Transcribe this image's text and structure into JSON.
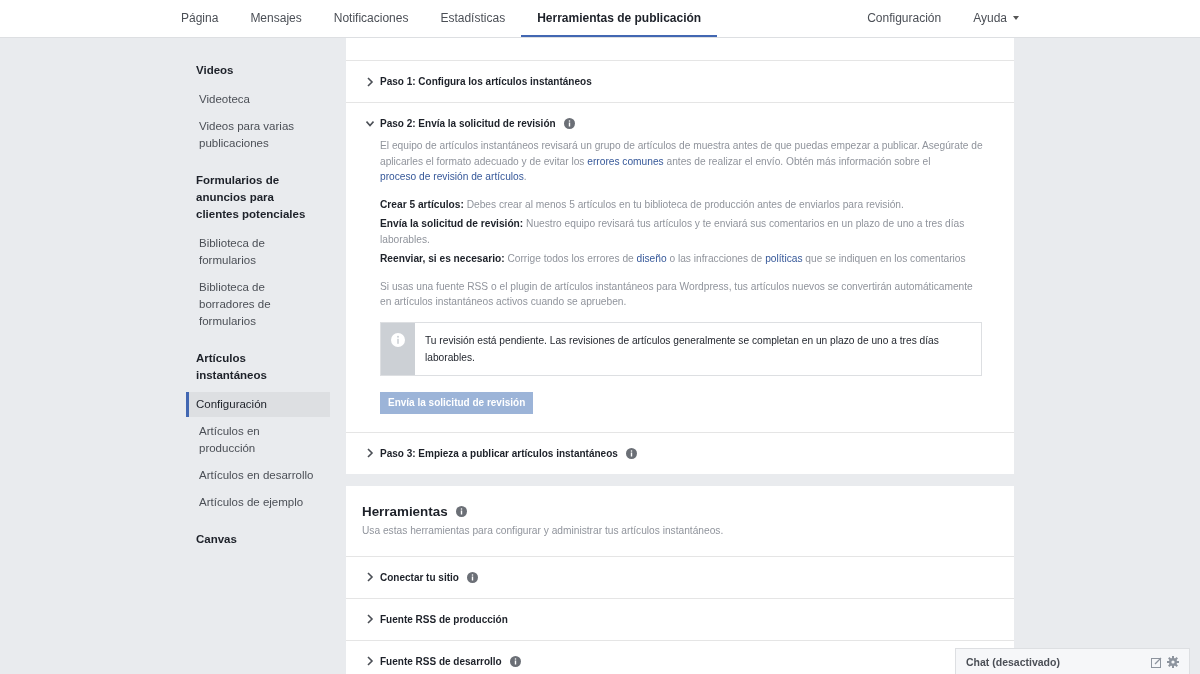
{
  "nav": {
    "tabs": [
      {
        "label": "Página",
        "selected": false
      },
      {
        "label": "Mensajes",
        "selected": false
      },
      {
        "label": "Notificaciones",
        "selected": false
      },
      {
        "label": "Estadísticas",
        "selected": false
      },
      {
        "label": "Herramientas de publicación",
        "selected": true
      }
    ],
    "right": [
      {
        "label": "Configuración",
        "kind": "link"
      },
      {
        "label": "Ayuda",
        "kind": "dropdown"
      }
    ]
  },
  "sidebar": {
    "sections": [
      {
        "title": "Videos",
        "items": [
          {
            "label": "Videoteca",
            "selected": false
          },
          {
            "label": "Videos para varias publicaciones",
            "selected": false
          }
        ]
      },
      {
        "title": "Formularios de anuncios para clientes potenciales",
        "items": [
          {
            "label": "Biblioteca de formularios",
            "selected": false
          },
          {
            "label": "Biblioteca de borradores de formularios",
            "selected": false
          }
        ]
      },
      {
        "title": "Artículos instantáneos",
        "items": [
          {
            "label": "Configuración",
            "selected": true
          },
          {
            "label": "Artículos en producción",
            "selected": false
          },
          {
            "label": "Artículos en desarrollo",
            "selected": false
          },
          {
            "label": "Artículos de ejemplo",
            "selected": false
          }
        ]
      },
      {
        "title": "Canvas"
      }
    ]
  },
  "steps": [
    {
      "title": "Paso 1: Configura los artículos instantáneos",
      "info_icon": false,
      "expanded": false
    },
    {
      "title": "Paso 2: Envía la solicitud de revisión",
      "info_icon": true,
      "expanded": true,
      "description": [
        {
          "kind": "text",
          "text": "El equipo de artículos instantáneos revisará un grupo de artículos de muestra antes de que puedas empezar a publicar. Asegúrate de aplicarles el formato adecuado y de evitar los "
        },
        {
          "kind": "link",
          "text": "errores comunes"
        },
        {
          "kind": "text",
          "text": " antes de realizar el envío. Obtén más información sobre el "
        },
        {
          "kind": "link",
          "text": "proceso de revisión de artículos"
        },
        {
          "kind": "text",
          "text": "."
        }
      ],
      "requirements": [
        {
          "label": "Crear 5 artículos:",
          "segments": [
            {
              "kind": "text",
              "text": "Debes crear al menos 5 artículos en tu biblioteca de producción antes de enviarlos para revisión."
            }
          ]
        },
        {
          "label": "Envía la solicitud de revisión:",
          "segments": [
            {
              "kind": "text",
              "text": "Nuestro equipo revisará tus artículos y te enviará sus comentarios en un plazo de uno a tres días laborables."
            }
          ]
        },
        {
          "label": "Reenviar, si es necesario:",
          "segments": [
            {
              "kind": "text",
              "text": "Corrige todos los errores de "
            },
            {
              "kind": "link",
              "text": "diseño"
            },
            {
              "kind": "text",
              "text": " o las infracciones de "
            },
            {
              "kind": "link",
              "text": "políticas"
            },
            {
              "kind": "text",
              "text": " que se indiquen en los comentarios"
            }
          ]
        }
      ],
      "note": "Si usas una fuente RSS o el plugin de artículos instantáneos para Wordpress, tus artículos nuevos se convertirán automáticamente en artículos instantáneos activos cuando se aprueben.",
      "notice": "Tu revisión está pendiente. Las revisiones de artículos generalmente se completan en un plazo de uno a tres días laborables.",
      "button": {
        "label": "Envía la solicitud de revisión",
        "disabled": true
      }
    },
    {
      "title": "Paso 3: Empieza a publicar artículos instantáneos",
      "info_icon": true,
      "expanded": false
    }
  ],
  "tools": {
    "title": "Herramientas",
    "subtitle": "Usa estas herramientas para configurar y administrar tus artículos instantáneos.",
    "items": [
      {
        "title": "Conectar tu sitio",
        "info_icon": true,
        "expanded": false
      },
      {
        "title": "Fuente RSS de producción",
        "info_icon": false,
        "expanded": false
      },
      {
        "title": "Fuente RSS de desarrollo",
        "info_icon": true,
        "expanded": false
      }
    ]
  },
  "chat": {
    "label": "Chat (desactivado)"
  }
}
